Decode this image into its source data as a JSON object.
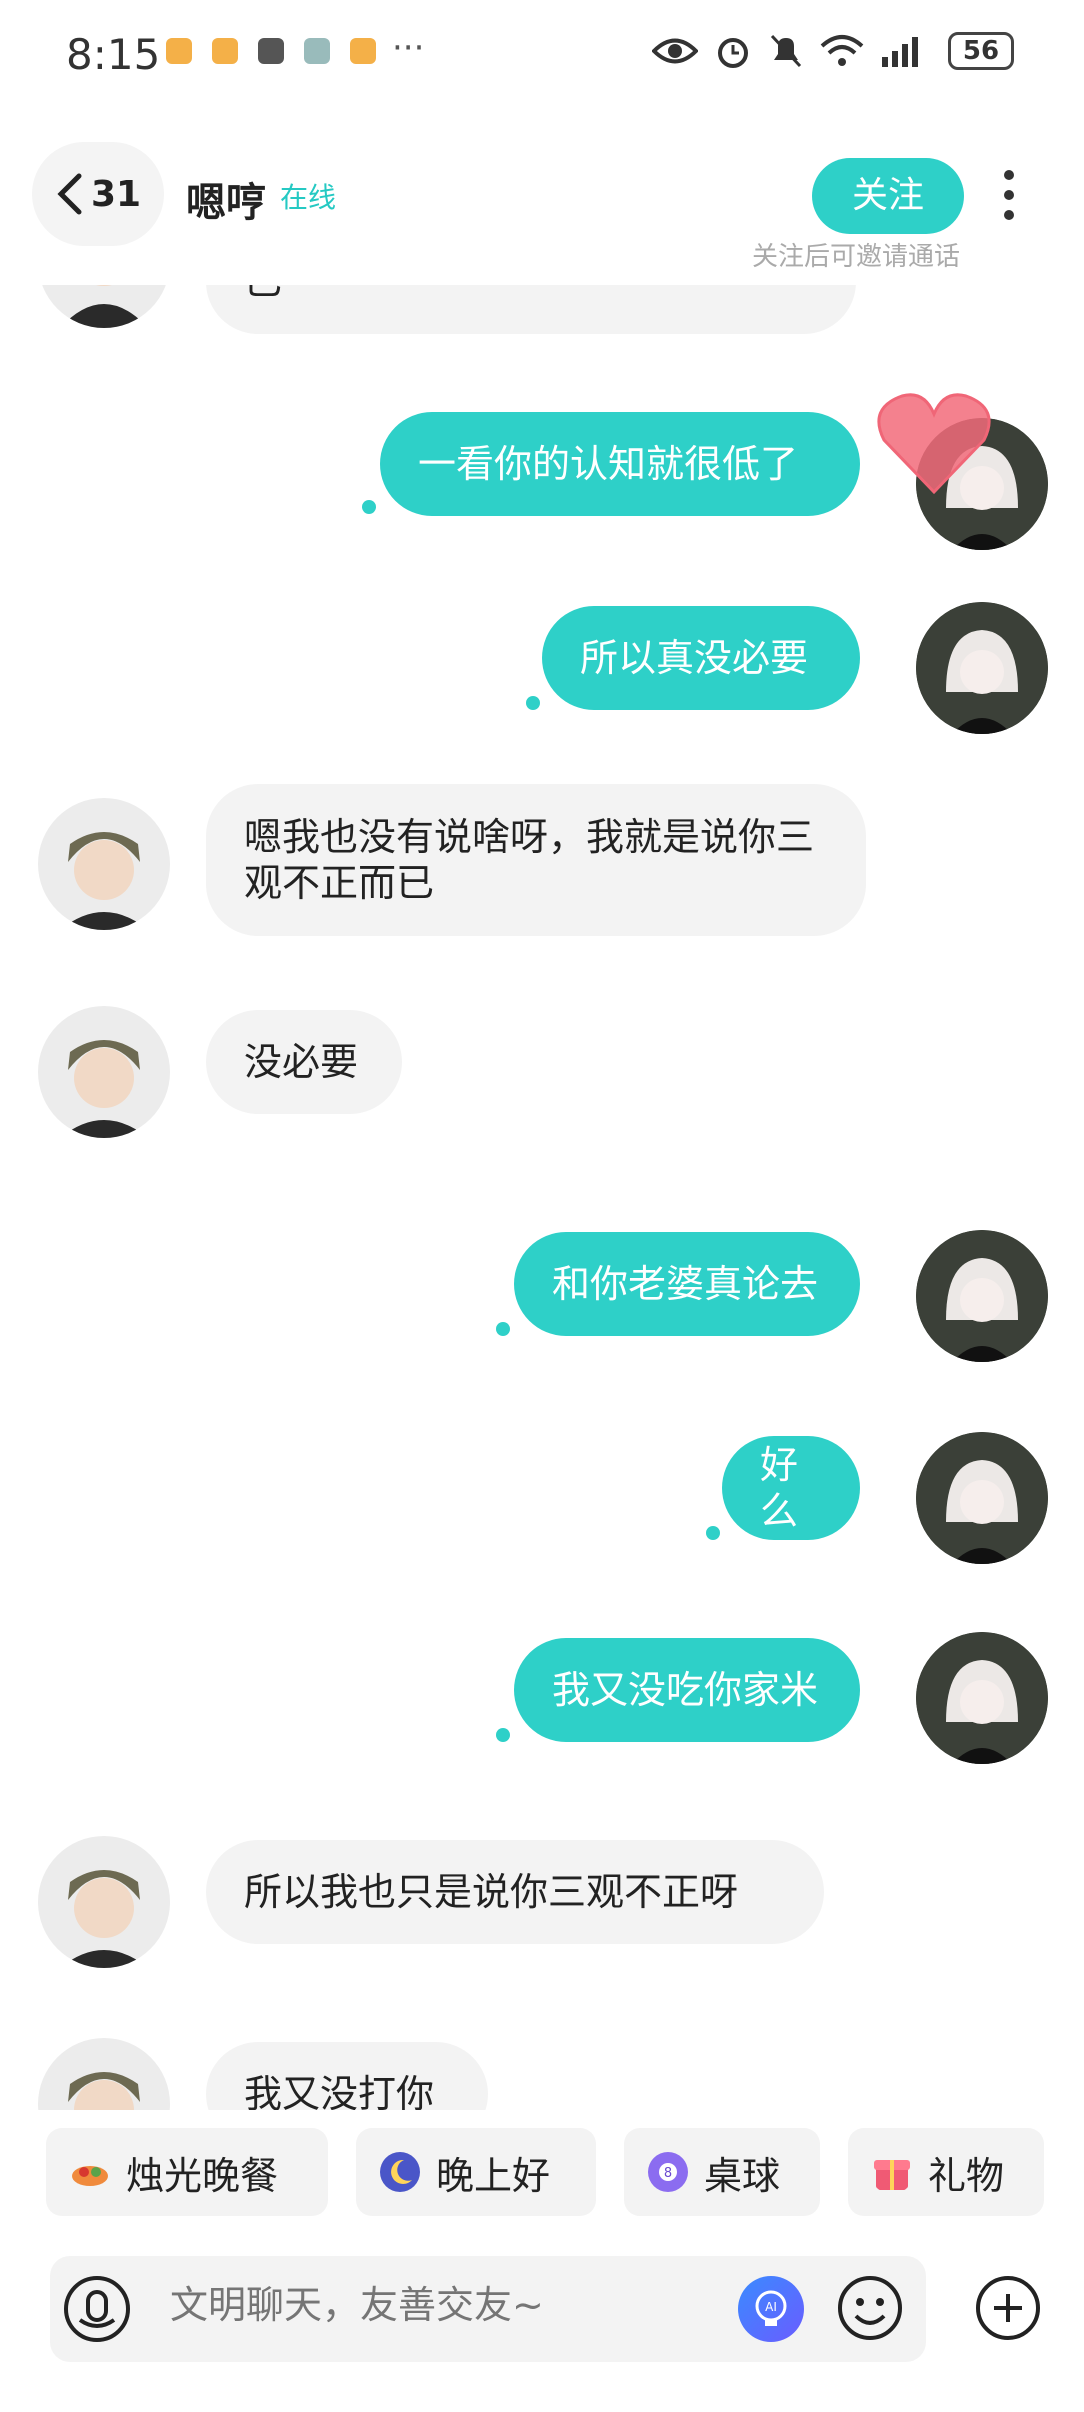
{
  "status_bar": {
    "time": "8:15",
    "more": "···",
    "battery": "56"
  },
  "header": {
    "back_count": "31",
    "contact_name": "嗯哼",
    "presence": "在线",
    "follow_label": "关注",
    "follow_hint": "关注后可邀请通话"
  },
  "messages": [
    {
      "side": "left",
      "text": "已"
    },
    {
      "side": "right",
      "text": "一看你的认知就很低了"
    },
    {
      "side": "right",
      "text": "所以真没必要"
    },
    {
      "side": "left",
      "text": "嗯我也没有说啥呀，我就是说你三观不正而已"
    },
    {
      "side": "left",
      "text": "没必要"
    },
    {
      "side": "right",
      "text": "和你老婆真论去"
    },
    {
      "side": "right",
      "text": "好么"
    },
    {
      "side": "right",
      "text": "我又没吃你家米"
    },
    {
      "side": "left",
      "text": "所以我也只是说你三观不正呀"
    },
    {
      "side": "left",
      "text": "我又没打你"
    }
  ],
  "quick_actions": [
    {
      "label": "烛光晚餐",
      "icon": "candlelight-dinner-icon"
    },
    {
      "label": "晚上好",
      "icon": "moon-icon"
    },
    {
      "label": "桌球",
      "icon": "billiard-ball-icon"
    },
    {
      "label": "礼物",
      "icon": "gift-icon"
    }
  ],
  "input": {
    "placeholder": "文明聊天，友善交友~"
  },
  "colors": {
    "accent": "#2ed0c8",
    "bubble_left": "#f3f3f3"
  }
}
